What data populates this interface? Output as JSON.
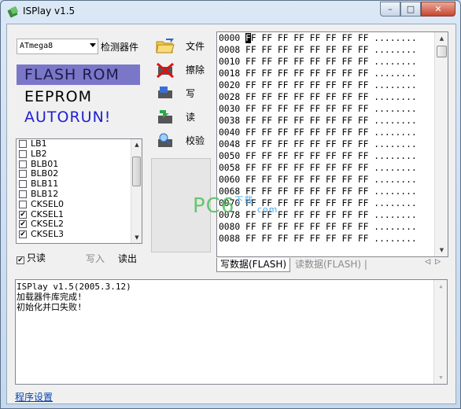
{
  "window": {
    "title": "ISPlay v1.5",
    "min": "–",
    "max": "□",
    "close": "✕"
  },
  "device": {
    "selected": "ATmega8",
    "detect_label": "检测器件"
  },
  "memory_tabs": [
    "FLASH ROM",
    "EEPROM",
    "AUTORUN!"
  ],
  "fuse_bits": [
    {
      "label": "LB1",
      "checked": false
    },
    {
      "label": "LB2",
      "checked": false
    },
    {
      "label": "BLB01",
      "checked": false
    },
    {
      "label": "BLB02",
      "checked": false
    },
    {
      "label": "BLB11",
      "checked": false
    },
    {
      "label": "BLB12",
      "checked": false
    },
    {
      "label": "CKSEL0",
      "checked": false
    },
    {
      "label": "CKSEL1",
      "checked": true
    },
    {
      "label": "CKSEL2",
      "checked": true
    },
    {
      "label": "CKSEL3",
      "checked": true
    }
  ],
  "readonly": {
    "label": "只读",
    "checked": true,
    "check_mark": "✔"
  },
  "fuse_actions": {
    "write": "写入",
    "read": "读出"
  },
  "toolbar": {
    "file": "文件",
    "erase": "擦除",
    "write": "写",
    "read": "读",
    "verify": "校验"
  },
  "hex": {
    "addresses": [
      "0000",
      "0008",
      "0010",
      "0018",
      "0020",
      "0028",
      "0030",
      "0038",
      "0040",
      "0048",
      "0050",
      "0058",
      "0060",
      "0068",
      "0070",
      "0078",
      "0080",
      "0088"
    ],
    "bytes": "FF FF FF FF FF FF FF FF",
    "ascii": "........"
  },
  "watermark": {
    "main": "PC6",
    "sub": "下载",
    "suffix": ".com"
  },
  "data_tabs": {
    "write_tab": "写数据(FLASH)",
    "read_tab": "读数据(FLASH)",
    "sep": "|",
    "nav": "◁▷"
  },
  "log": {
    "lines": [
      "ISPlay v1.5(2005.3.12)",
      "加载器件库完成!",
      "初始化并口失败!"
    ]
  },
  "settings_link": "程序设置"
}
